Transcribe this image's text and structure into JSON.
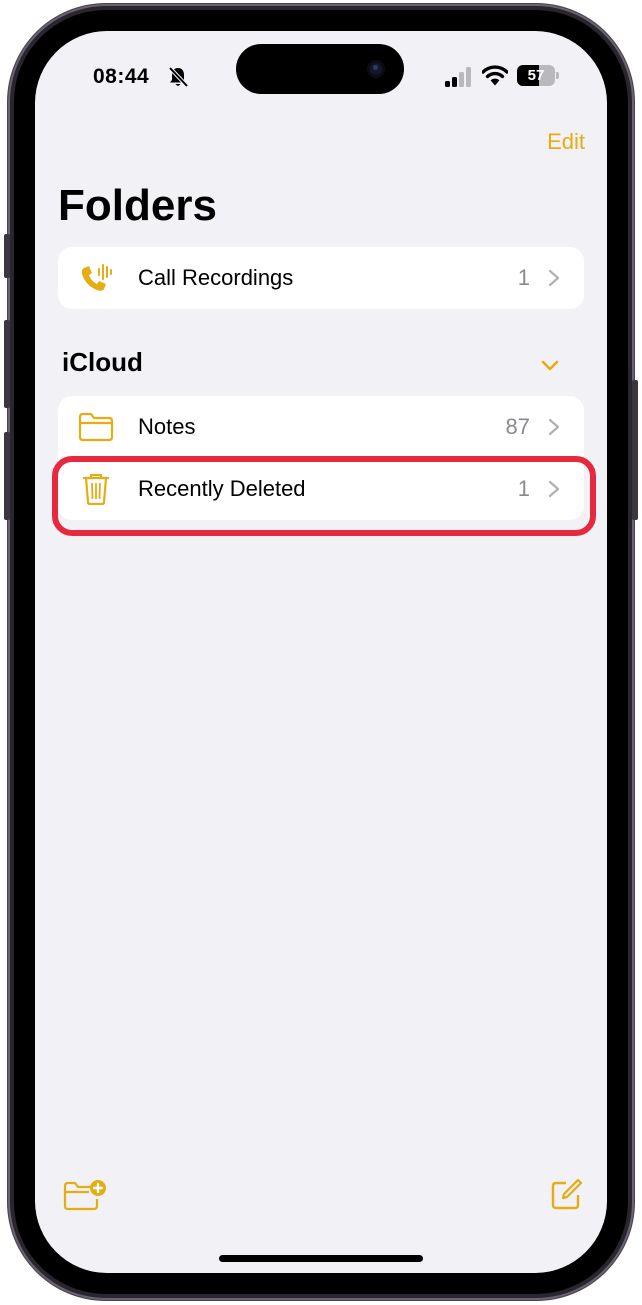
{
  "status_bar": {
    "time": "08:44",
    "battery_level": "57",
    "battery_fraction": 0.57,
    "icons": [
      "bell-slash-icon",
      "cellular-signal-icon",
      "wifi-icon",
      "battery-icon"
    ]
  },
  "nav": {
    "edit_label": "Edit",
    "title": "Folders"
  },
  "pinned_folders": [
    {
      "label": "Call Recordings",
      "count": "1",
      "icon": "phone-waveform-icon"
    }
  ],
  "icloud": {
    "section_title": "iCloud",
    "folders": [
      {
        "label": "Notes",
        "count": "87",
        "icon": "folder-icon"
      },
      {
        "label": "Recently Deleted",
        "count": "1",
        "icon": "trash-icon"
      }
    ]
  },
  "toolbar": {
    "icons": [
      "new-folder-icon",
      "compose-icon"
    ]
  },
  "colors": {
    "accent": "#e5ad12",
    "highlight": "#e8283e",
    "background": "#f2f1f6"
  }
}
